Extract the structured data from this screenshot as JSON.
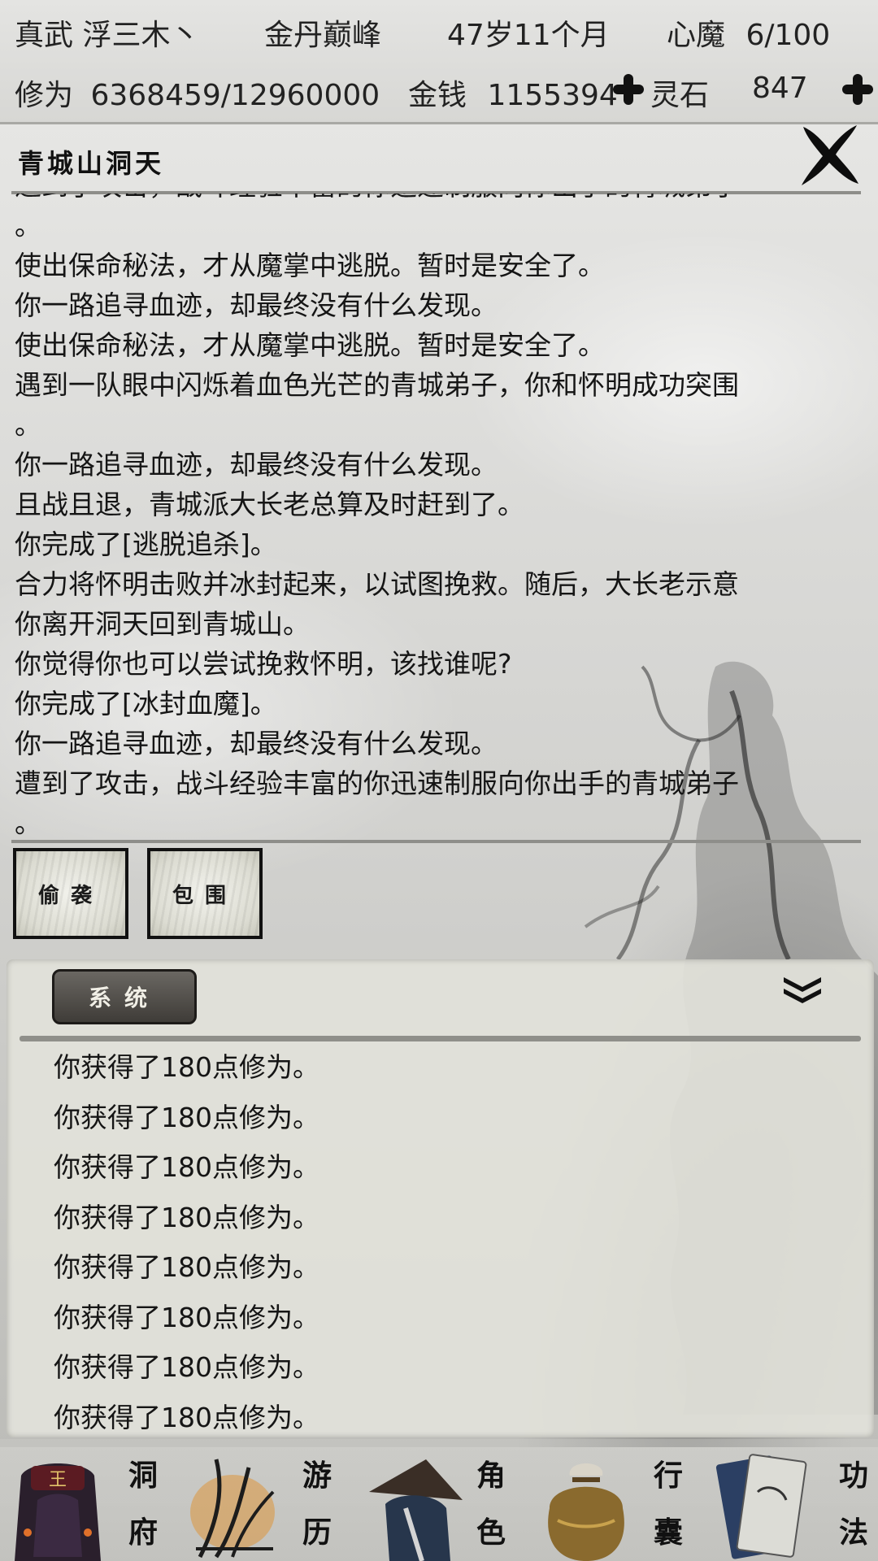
{
  "status": {
    "name": "真武 浮三木丶",
    "realm": "金丹巅峰",
    "age": "47岁11个月",
    "heart_demon_label": "心魔",
    "heart_demon_value": "6/100",
    "cultivation_label": "修为",
    "cultivation_value": "6368459/12960000",
    "money_label": "金钱",
    "money_value": "1155394",
    "spirit_stone_label": "灵石",
    "spirit_stone_value": "847"
  },
  "event": {
    "title": "青城山洞天",
    "log": [
      "遭到了攻击，战斗经验丰富的你迅速制服向你出手的青城弟子",
      "。",
      "使出保命秘法，才从魔掌中逃脱。暂时是安全了。",
      "你一路追寻血迹，却最终没有什么发现。",
      "使出保命秘法，才从魔掌中逃脱。暂时是安全了。",
      "遇到一队眼中闪烁着血色光芒的青城弟子，你和怀明成功突围",
      "。",
      "你一路追寻血迹，却最终没有什么发现。",
      "且战且退，青城派大长老总算及时赶到了。",
      "你完成了[逃脱追杀]。",
      "合力将怀明击败并冰封起来，以试图挽救。随后，大长老示意",
      "你离开洞天回到青城山。",
      "你觉得你也可以尝试挽救怀明，该找谁呢?",
      "你完成了[冰封血魔]。",
      "你一路追寻血迹，却最终没有什么发现。",
      "遭到了攻击，战斗经验丰富的你迅速制服向你出手的青城弟子",
      "。"
    ],
    "actions": [
      "偷袭",
      "包围"
    ]
  },
  "system": {
    "tab_label": "系统",
    "messages": [
      "你获得了180点修为。",
      "你获得了180点修为。",
      "你获得了180点修为。",
      "你获得了180点修为。",
      "你获得了180点修为。",
      "你获得了180点修为。",
      "你获得了180点修为。",
      "你获得了180点修为。"
    ]
  },
  "nav": [
    {
      "chars": [
        "洞",
        "府"
      ],
      "icon": "cave-dwelling-icon"
    },
    {
      "chars": [
        "游",
        "历"
      ],
      "icon": "travel-icon"
    },
    {
      "chars": [
        "角",
        "色"
      ],
      "icon": "character-icon"
    },
    {
      "chars": [
        "行",
        "囊"
      ],
      "icon": "bag-icon"
    },
    {
      "chars": [
        "功",
        "法"
      ],
      "icon": "scroll-book-icon"
    }
  ]
}
